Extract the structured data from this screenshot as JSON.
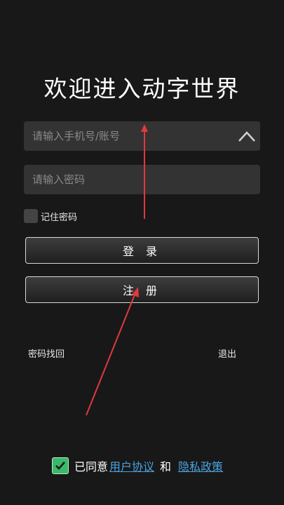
{
  "title": "欢迎进入动字世界",
  "account": {
    "placeholder": "请输入手机号/账号",
    "value": ""
  },
  "password": {
    "placeholder": "请输入密码",
    "value": ""
  },
  "remember": {
    "label": "记住密码",
    "checked": false
  },
  "buttons": {
    "login": "登 录",
    "register": "注 册"
  },
  "links": {
    "recover": "密码找回",
    "quit": "退出"
  },
  "agreement": {
    "checked": true,
    "prefix": "已同意",
    "user_agreement": "用户协议",
    "and": "和",
    "privacy_policy": "隐私政策"
  },
  "colors": {
    "background": "#181818",
    "field": "#333333",
    "check": "#39b969",
    "link": "#4aa3e0",
    "annotation": "#e0393e"
  }
}
